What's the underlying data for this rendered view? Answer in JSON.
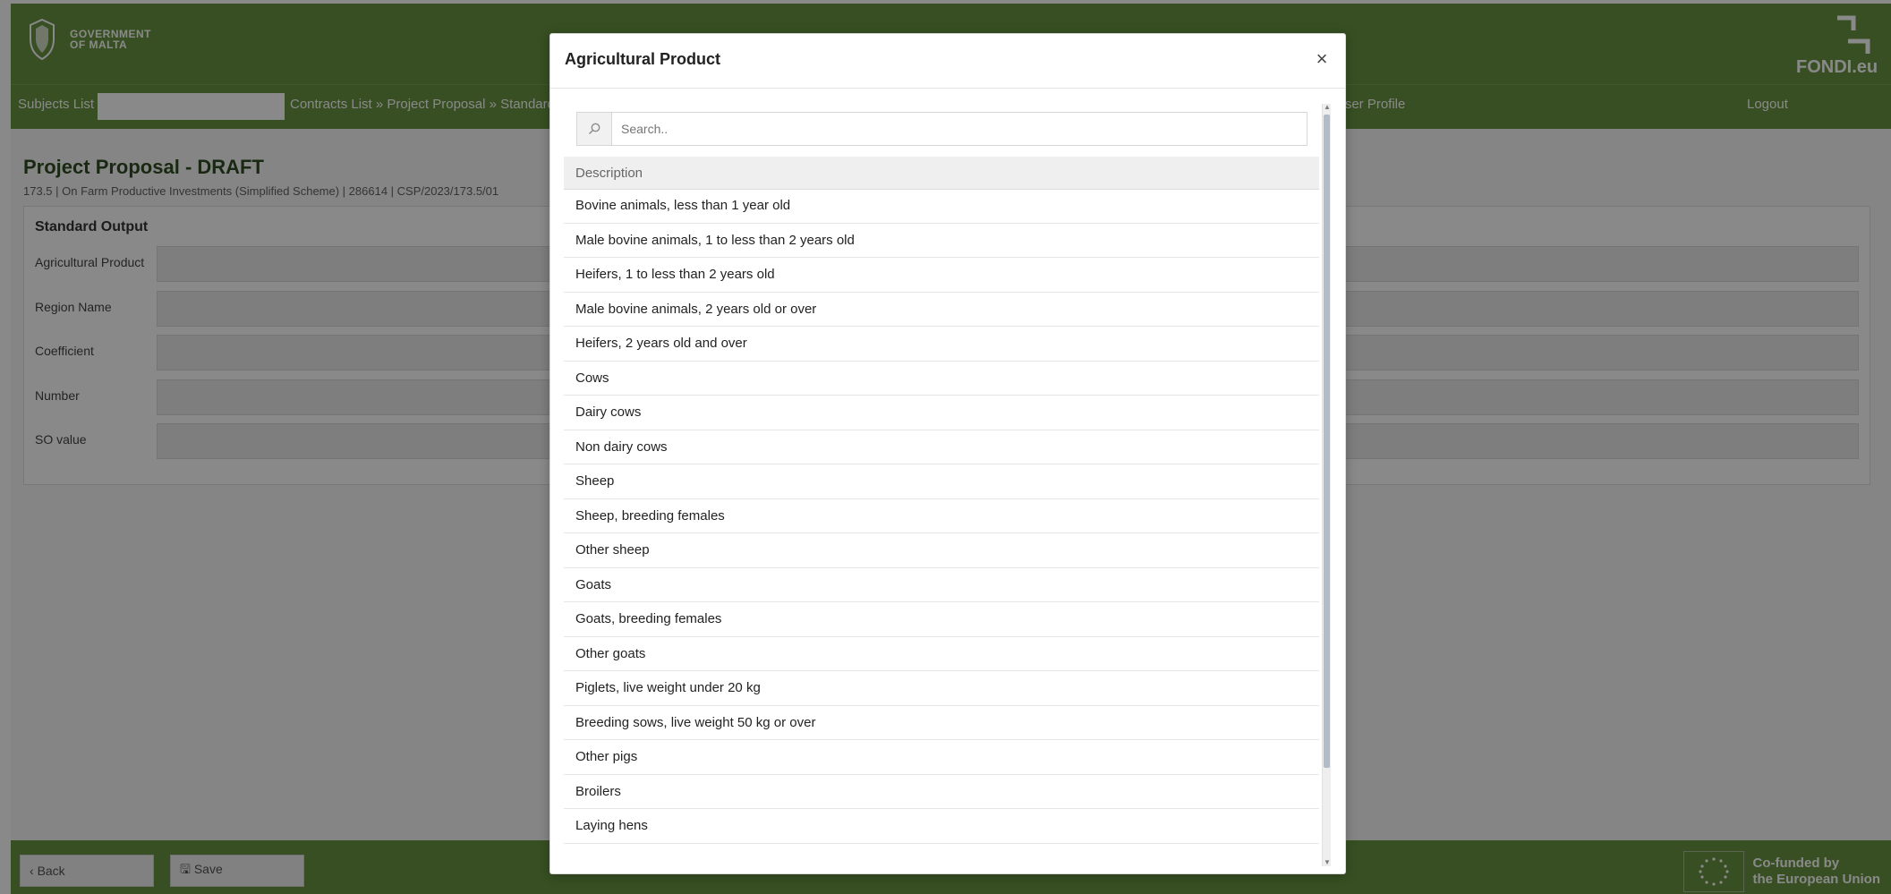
{
  "brand": {
    "government": [
      "GOVERNMENT",
      "OF MALTA"
    ],
    "fondi": "FONDI.eu",
    "eu": [
      "Co-funded by",
      "the European Union"
    ]
  },
  "nav": {
    "subjects": "Subjects List",
    "breadcrumb": "Contracts List » Project Proposal » Standard",
    "profile": "User Profile",
    "logout": "Logout"
  },
  "page": {
    "title": "Project Proposal - DRAFT",
    "subtitle": "173.5 | On Farm Productive Investments (Simplified Scheme) | 286614 | CSP/2023/173.5/01",
    "panel_title": "Standard Output",
    "fields": [
      "Agricultural Product",
      "Region Name",
      "Coefficient",
      "Number",
      "SO value"
    ]
  },
  "footer": {
    "back": "Back",
    "save": "Save"
  },
  "modal": {
    "title": "Agricultural Product",
    "search_placeholder": "Search..",
    "column": "Description",
    "items": [
      "Bovine animals, less than 1 year old",
      "Male bovine animals, 1 to less than 2 years old",
      "Heifers, 1 to less than 2 years old",
      "Male bovine animals, 2 years old or over",
      "Heifers, 2 years old and over",
      "Cows",
      "Dairy cows",
      "Non dairy cows",
      "Sheep",
      "Sheep, breeding females",
      "Other sheep",
      "Goats",
      "Goats, breeding females",
      "Other goats",
      "Piglets, live weight under 20 kg",
      "Breeding sows, live weight 50 kg or over",
      "Other pigs",
      "Broilers",
      "Laying hens"
    ]
  },
  "colors": {
    "header_green": "#5a8a31",
    "overlay": "rgba(20,20,20,0.5)",
    "modal_bg": "#ffffff"
  }
}
